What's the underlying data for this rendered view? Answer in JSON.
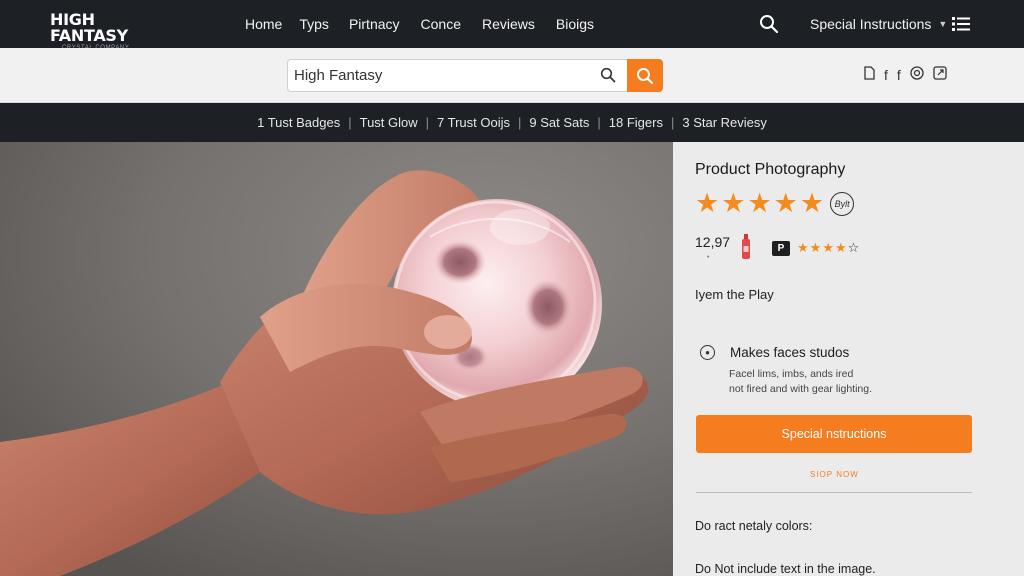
{
  "brand": {
    "name": "HIGH FANTASY",
    "tagline": "CRYSTAL COMPANY"
  },
  "nav": {
    "links": [
      "Home",
      "Typs",
      "Pirtnacy",
      "Conce",
      "Reviews",
      "Bioigs"
    ],
    "special_menu": "Special Instructions"
  },
  "search": {
    "value": "High Fantasy",
    "placeholder": "High Fantasy"
  },
  "trust": {
    "items": [
      "1 Tust Badges",
      "Tust Glow",
      "7 Trust Ooijs",
      "9 Sat Sats",
      "18 Figers",
      "3 Star Reviesy"
    ]
  },
  "product": {
    "title": "Product Photography",
    "rating_stars": 5,
    "rating_badge": "Bylt",
    "price": "12,97",
    "price_subdot": "•",
    "badge_letter": "P",
    "small_rating": 4,
    "small_rating_max": 5,
    "play_text": "Iyem the Play",
    "feature": {
      "title": "Makes faces studos",
      "desc_line1": "Facel lims, imbs, ands ired",
      "desc_line2": "not fired and with gear lighting."
    },
    "cta_label": "Special nstructions",
    "shop_label": "SIOP NOW",
    "note1": "Do ract netaly colors:",
    "note2": "Do Not include text in the image."
  },
  "colors": {
    "accent": "#f57c1f",
    "nav_bg": "#1d2126",
    "panel_bg": "#ebebeb"
  }
}
